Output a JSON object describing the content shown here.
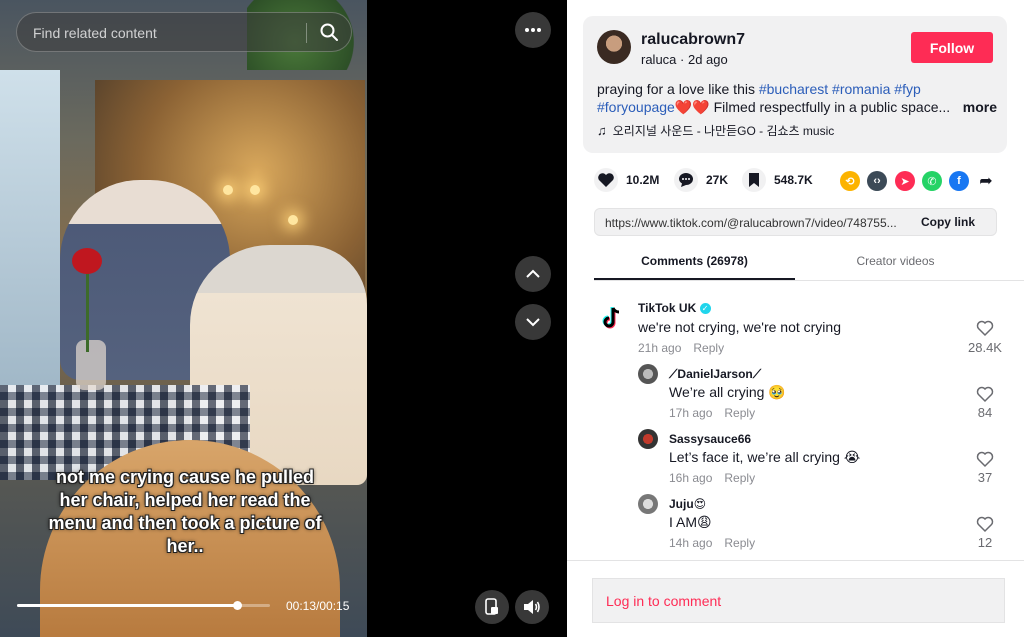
{
  "video": {
    "search_placeholder": "Find related content",
    "caption": "not me crying cause he pulled her chair, helped her read the menu and then took a picture of her..",
    "time_current": "00:13",
    "time_total": "00:15",
    "time_display": "00:13/00:15",
    "progress_fraction": 0.87
  },
  "post": {
    "username": "ralucabrown7",
    "display_name": "raluca",
    "age": "2d ago",
    "sub_line": "raluca · 2d ago",
    "follow_label": "Follow",
    "desc_text": "praying for a love like this",
    "hashtags": [
      "#bucharest",
      "#romania",
      "#fyp",
      "#foryoupage"
    ],
    "hearts": "❤️❤️",
    "desc_tail": "Filmed respectfully in a public space...",
    "more_label": "more",
    "music": "오리지널 사운드 - 나만듣GO - 김쇼츠 music",
    "likes": "10.2M",
    "comments_count": "27K",
    "saves": "548.7K",
    "url": "https://www.tiktok.com/@ralucabrown7/video/748755...",
    "copy_label": "Copy link"
  },
  "tabs": {
    "comments": "Comments (26978)",
    "creator": "Creator videos"
  },
  "comments": [
    {
      "name": "TikTok UK",
      "text": "we're not crying, we're not crying",
      "time": "21h ago",
      "reply": "Reply",
      "likes": "28.4K"
    },
    {
      "name": "⟋DanielJarson⟋",
      "text": "We’re all crying 🥹",
      "time": "17h ago",
      "reply": "Reply",
      "likes": "84"
    },
    {
      "name": "Sassysauce66",
      "text": "Let’s face it, we’re all crying 😭",
      "time": "16h ago",
      "reply": "Reply",
      "likes": "37"
    },
    {
      "name": "Juju😍",
      "text": "I AM😩",
      "time": "14h ago",
      "reply": "Reply",
      "likes": "12"
    }
  ],
  "login_label": "Log in to comment",
  "colors": {
    "accent": "#fe2c55",
    "hashtag": "#2b5db9",
    "text": "#161823"
  }
}
